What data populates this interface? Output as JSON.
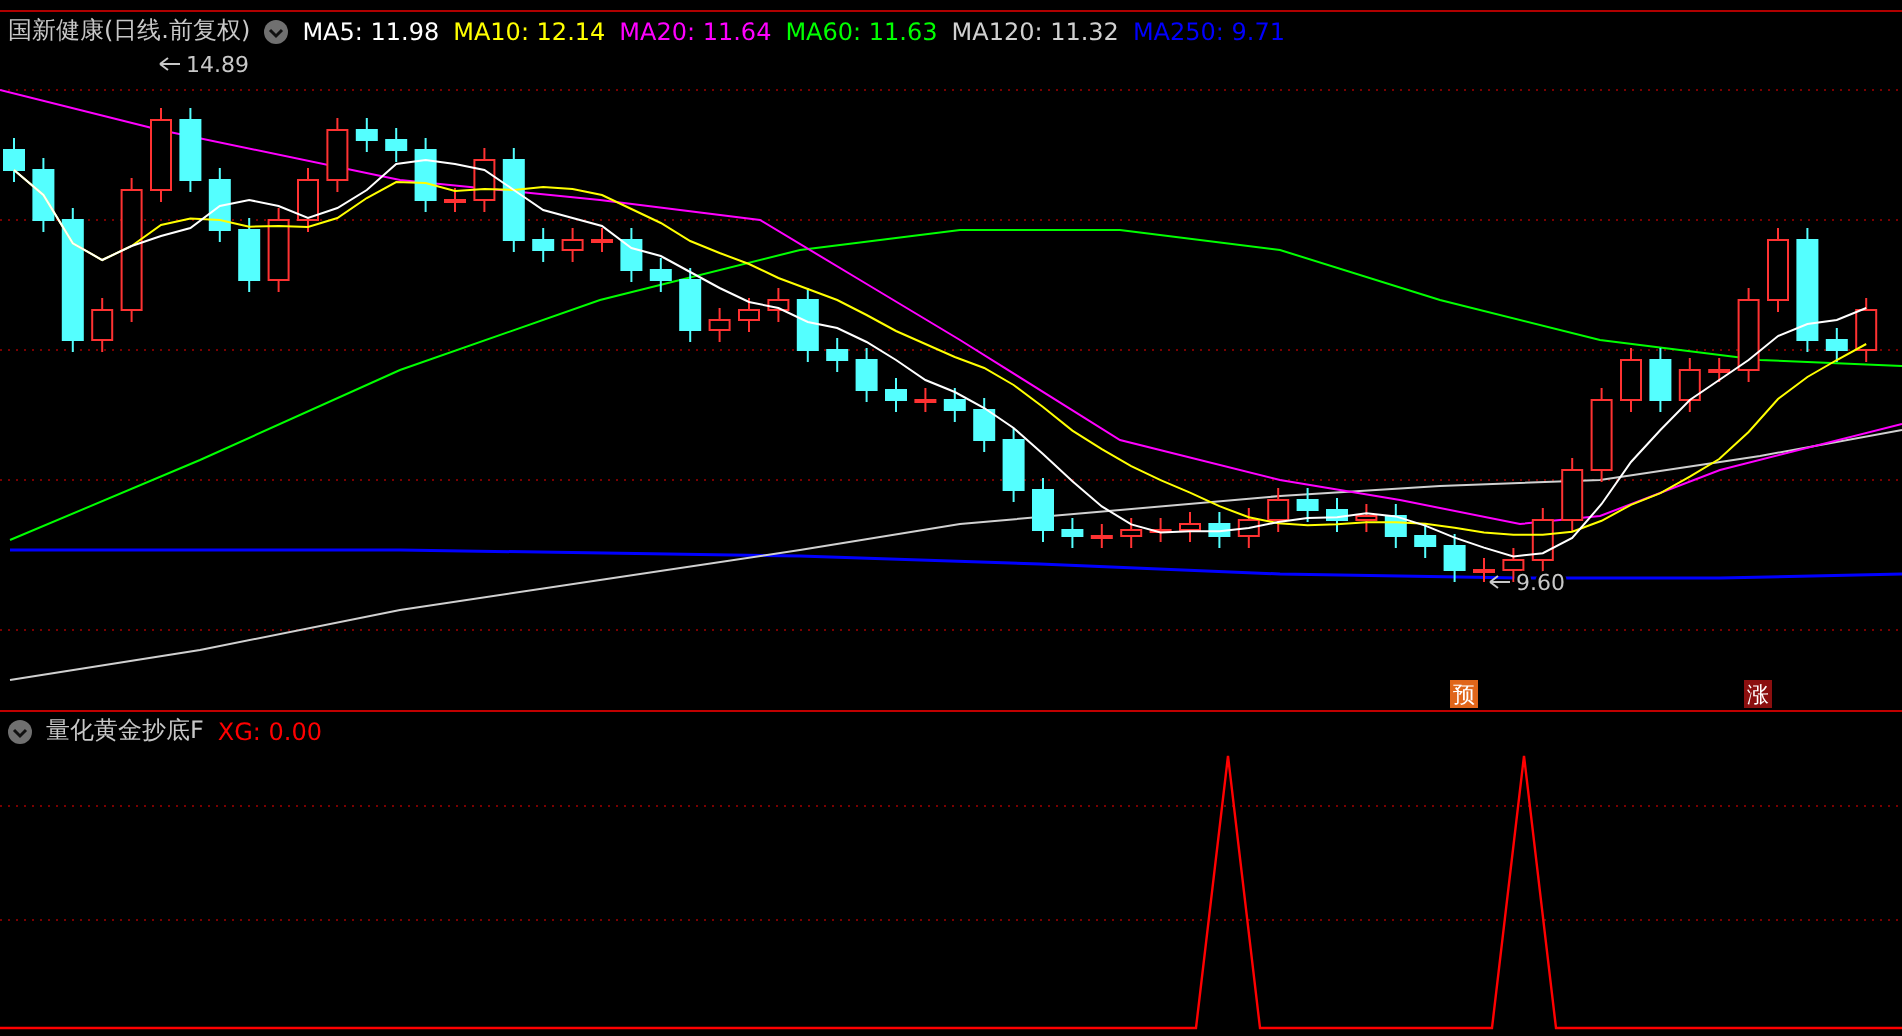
{
  "main_panel": {
    "title": "国新健康(日线.前复权)",
    "moving_averages": [
      {
        "label": "MA5: 11.98",
        "color": "#ffffff"
      },
      {
        "label": "MA10: 12.14",
        "color": "#ffff00"
      },
      {
        "label": "MA20: 11.64",
        "color": "#ff00ff"
      },
      {
        "label": "MA60: 11.63",
        "color": "#00ff00"
      },
      {
        "label": "MA120: 11.32",
        "color": "#d0d0d0"
      },
      {
        "label": "MA250: 9.71",
        "color": "#0000ff"
      }
    ],
    "annotations": [
      {
        "kind": "high",
        "text": "14.89"
      },
      {
        "kind": "low",
        "text": "9.60"
      }
    ],
    "signals": [
      {
        "text": "预",
        "color": "#e0661a"
      },
      {
        "text": "涨",
        "color": "#8b0f0f"
      }
    ]
  },
  "indicator_panel": {
    "title": "量化黄金抄底F",
    "value": "XG: 0.00"
  }
}
